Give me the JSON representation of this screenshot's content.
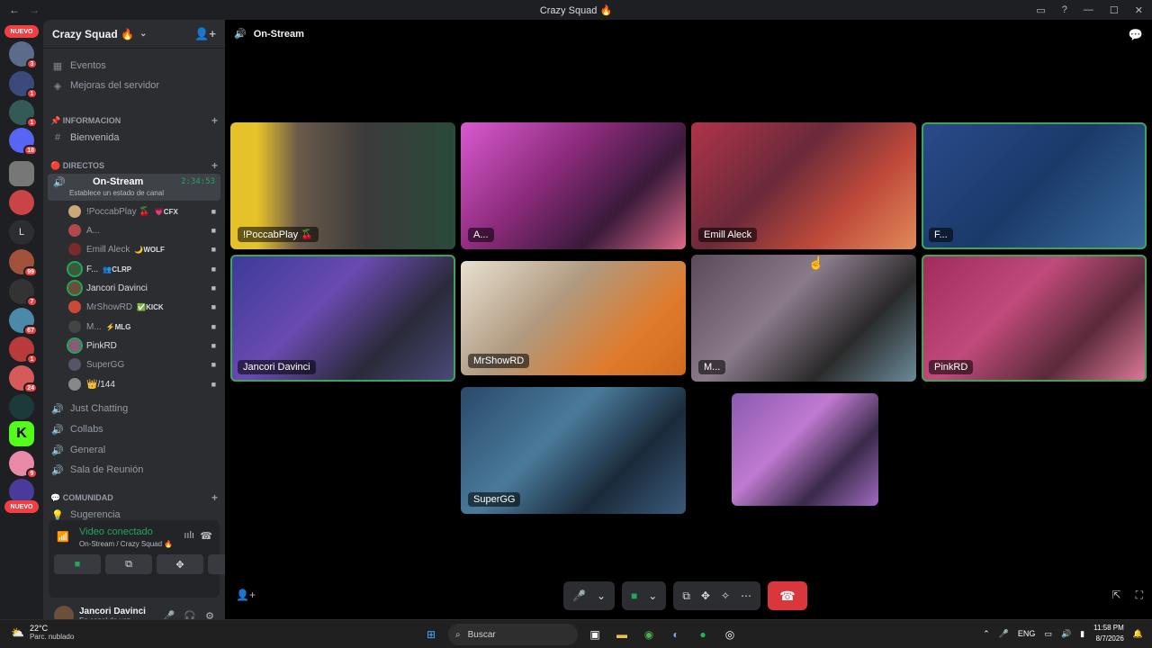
{
  "window": {
    "title": "Crazy Squad 🔥"
  },
  "rail": {
    "new_top": "NUEVO",
    "new_bottom": "NUEVO",
    "letter_server": "L",
    "badges": [
      "3",
      "1",
      "1",
      "18",
      "99",
      "7",
      "67",
      "1",
      "24",
      "9"
    ]
  },
  "server": {
    "name": "Crazy Squad 🔥",
    "events": "Eventos",
    "boosts": "Mejoras del servidor",
    "cat_info": "📌 INFORMACION",
    "welcome": "Bienvenida",
    "cat_directos": "🔴 DIRECTOS",
    "active_channel": "On-Stream",
    "active_sub": "Establece un estado de canal",
    "active_time": "2:34:53",
    "members": [
      {
        "name": "!PoccabPlay 🍒",
        "tag": "💗CFX"
      },
      {
        "name": "A...",
        "tag": ""
      },
      {
        "name": "Emill Aleck",
        "tag": "🌙WOLF"
      },
      {
        "name": "F...",
        "tag": "👥CLRP"
      },
      {
        "name": "Jancori Davinci",
        "tag": ""
      },
      {
        "name": "MrShowRD",
        "tag": "✅KICK"
      },
      {
        "name": "M...",
        "tag": "⚡MLG"
      },
      {
        "name": "PinkRD",
        "tag": ""
      },
      {
        "name": "SuperGG",
        "tag": ""
      },
      {
        "name": "👑/144",
        "tag": ""
      }
    ],
    "voice_channels": [
      "Just Chatting",
      "Collabs",
      "General",
      "Sala de Reunión"
    ],
    "cat_comunidad": "💬 COMUNIDAD",
    "suggestion": "Sugerencia"
  },
  "voice": {
    "status": "Video conectado",
    "location": "On-Stream / Crazy Squad 🔥"
  },
  "user": {
    "name": "Jancori Davinci",
    "status": "En canal de voz"
  },
  "stage": {
    "channel": "On-Stream",
    "tiles": [
      {
        "label": "!PoccabPlay 🍒"
      },
      {
        "label": "A..."
      },
      {
        "label": "Emill Aleck"
      },
      {
        "label": "F..."
      },
      {
        "label": "Jancori Davinci"
      },
      {
        "label": "MrShowRD"
      },
      {
        "label": "M..."
      },
      {
        "label": "PinkRD"
      },
      {
        "label": "SuperGG"
      },
      {
        "label": ""
      }
    ]
  },
  "taskbar": {
    "temp": "22°C",
    "weather": "Parc. nublado",
    "search": "Buscar",
    "lang": "ENG",
    "time": "11:58 PM",
    "date": "8/7/2026"
  },
  "colors": {
    "accent_green": "#23a55a",
    "hangup_red": "#da373c",
    "badge_red": "#f23f43",
    "bg_dark": "#1e1f22"
  }
}
